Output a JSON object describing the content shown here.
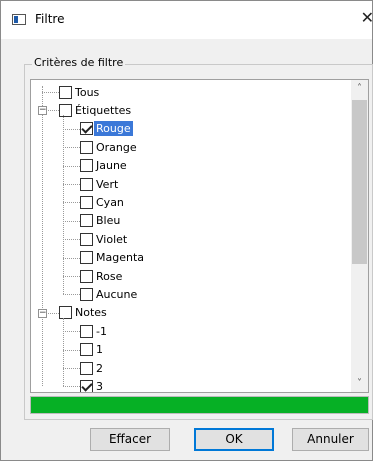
{
  "window": {
    "title": "Filtre",
    "close_glyph": "✕"
  },
  "group": {
    "label": "Critères de filtre"
  },
  "tree": {
    "nodes": [
      {
        "id": "tous",
        "label": "Tous",
        "level": 0,
        "checked": false,
        "expander": null,
        "selected": false
      },
      {
        "id": "etiquettes",
        "label": "Étiquettes",
        "level": 0,
        "checked": false,
        "expander": "minus",
        "selected": false
      },
      {
        "id": "rouge",
        "label": "Rouge",
        "level": 1,
        "checked": true,
        "expander": null,
        "selected": true
      },
      {
        "id": "orange",
        "label": "Orange",
        "level": 1,
        "checked": false,
        "expander": null,
        "selected": false
      },
      {
        "id": "jaune",
        "label": "Jaune",
        "level": 1,
        "checked": false,
        "expander": null,
        "selected": false
      },
      {
        "id": "vert",
        "label": "Vert",
        "level": 1,
        "checked": false,
        "expander": null,
        "selected": false
      },
      {
        "id": "cyan",
        "label": "Cyan",
        "level": 1,
        "checked": false,
        "expander": null,
        "selected": false
      },
      {
        "id": "bleu",
        "label": "Bleu",
        "level": 1,
        "checked": false,
        "expander": null,
        "selected": false
      },
      {
        "id": "violet",
        "label": "Violet",
        "level": 1,
        "checked": false,
        "expander": null,
        "selected": false
      },
      {
        "id": "magenta",
        "label": "Magenta",
        "level": 1,
        "checked": false,
        "expander": null,
        "selected": false
      },
      {
        "id": "rose",
        "label": "Rose",
        "level": 1,
        "checked": false,
        "expander": null,
        "selected": false
      },
      {
        "id": "aucune",
        "label": "Aucune",
        "level": 1,
        "checked": false,
        "expander": null,
        "selected": false
      },
      {
        "id": "notes",
        "label": "Notes",
        "level": 0,
        "checked": false,
        "expander": "minus",
        "selected": false
      },
      {
        "id": "note-m1",
        "label": "-1",
        "level": 1,
        "checked": false,
        "expander": null,
        "selected": false
      },
      {
        "id": "note-1",
        "label": "1",
        "level": 1,
        "checked": false,
        "expander": null,
        "selected": false
      },
      {
        "id": "note-2",
        "label": "2",
        "level": 1,
        "checked": false,
        "expander": null,
        "selected": false
      },
      {
        "id": "note-3",
        "label": "3",
        "level": 1,
        "checked": true,
        "expander": null,
        "selected": false
      }
    ]
  },
  "scrollbar": {
    "up_glyph": "˄",
    "down_glyph": "˅"
  },
  "progress": {
    "value_percent": 100,
    "color": "#06b025"
  },
  "buttons": {
    "clear": "Effacer",
    "ok": "OK",
    "cancel": "Annuler"
  },
  "colors": {
    "selection": "#3b78d8",
    "dialog_bg": "#f0f0f0",
    "default_button_border": "#0078d7"
  }
}
